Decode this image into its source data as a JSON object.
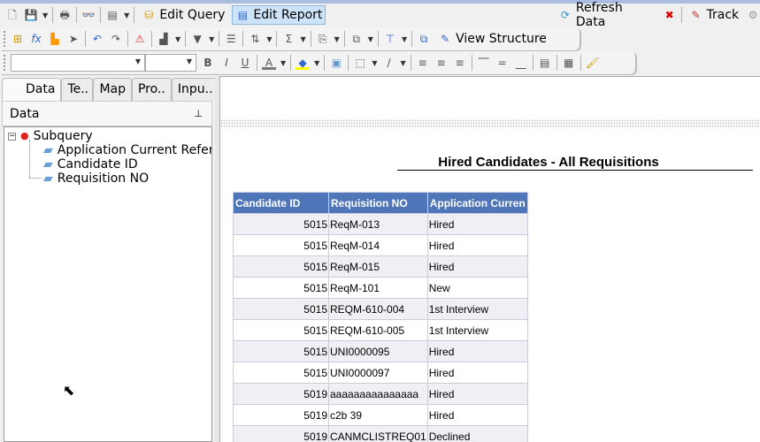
{
  "toolbar": {
    "edit_query": "Edit Query",
    "edit_report": "Edit Report",
    "refresh_data": "Refresh Data",
    "track": "Track",
    "view_structure": "View Structure"
  },
  "left": {
    "tabs": [
      "Data",
      "Te..",
      "Map",
      "Pro..",
      "Inpu.."
    ],
    "panel_title": "Data",
    "tree": {
      "root": "Subquery",
      "children": [
        "Application Current Refere",
        "Candidate ID",
        "Requisition NO"
      ]
    }
  },
  "report": {
    "title": "Hired Candidates - All Requisitions",
    "columns": [
      "Candidate ID",
      "Requisition NO",
      "Application Curren"
    ],
    "rows": [
      [
        "5015",
        "ReqM-013",
        "Hired"
      ],
      [
        "5015",
        "ReqM-014",
        "Hired"
      ],
      [
        "5015",
        "ReqM-015",
        "Hired"
      ],
      [
        "5015",
        "ReqM-101",
        "New"
      ],
      [
        "5015",
        "REQM-610-004",
        "1st Interview"
      ],
      [
        "5015",
        "REQM-610-005",
        "1st Interview"
      ],
      [
        "5015",
        "UNI0000095",
        "Hired"
      ],
      [
        "5015",
        "UNI0000097",
        "Hired"
      ],
      [
        "5019",
        "aaaaaaaaaaaaaaa",
        "Hired"
      ],
      [
        "5019",
        "c2b 39",
        "Hired"
      ],
      [
        "5019",
        "CANMCLISTREQ01",
        "Declined"
      ]
    ]
  }
}
